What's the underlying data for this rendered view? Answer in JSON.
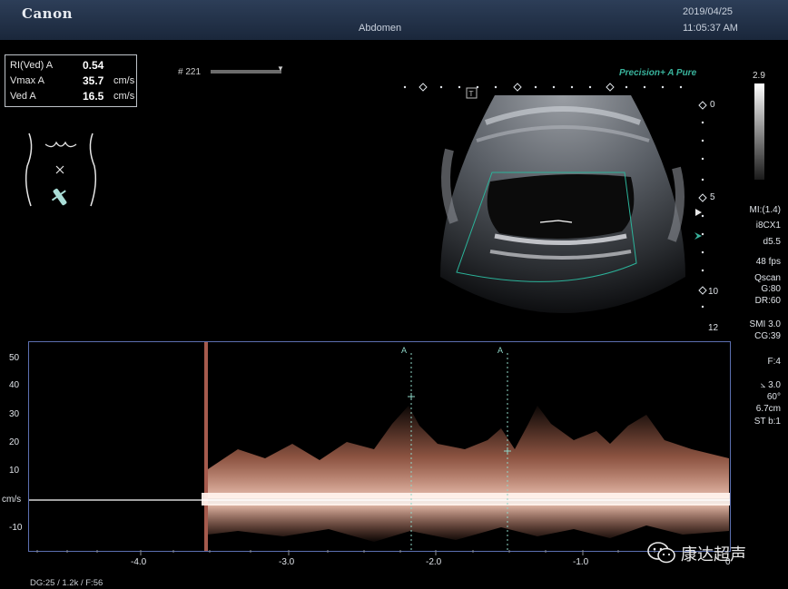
{
  "header": {
    "brand": "Canon",
    "exam": "Abdomen",
    "date": "2019/04/25",
    "time": "11:05:37 AM"
  },
  "measurements": [
    {
      "label": "RI(Ved) A",
      "value": "0.54",
      "unit": ""
    },
    {
      "label": "Vmax A",
      "value": "35.7",
      "unit": "cm/s"
    },
    {
      "label": "Ved A",
      "value": "16.5",
      "unit": "cm/s"
    }
  ],
  "frame": {
    "label": "# 221"
  },
  "mode_label": "Precision+ A Pure",
  "gray_scale": {
    "max": "2.9"
  },
  "side_params": [
    "MI:(1.4)",
    "i8CX1",
    "d5.5",
    "48 fps",
    "Qscan",
    "G:80",
    "DR:60",
    "SMI 3.0",
    "CG:39",
    "F:4",
    "3.0",
    "60°",
    "6.7cm",
    "ST b:1"
  ],
  "depth_scale": [
    "0",
    "5",
    "10",
    "12"
  ],
  "doppler": {
    "y_ticks": [
      "50",
      "40",
      "30",
      "20",
      "10",
      "cm/s",
      "-10"
    ],
    "x_ticks": [
      "-4.0",
      "-3.0",
      "-2.0",
      "-1.0",
      "0"
    ],
    "markers": [
      "A",
      "A"
    ]
  },
  "footer": "DG:25  / 1.2k  / F:56",
  "watermark": "康达超声",
  "colors": {
    "accent": "#39b39c",
    "spectrum": "#e88a6c",
    "frame_border": "#5c6fb0"
  }
}
